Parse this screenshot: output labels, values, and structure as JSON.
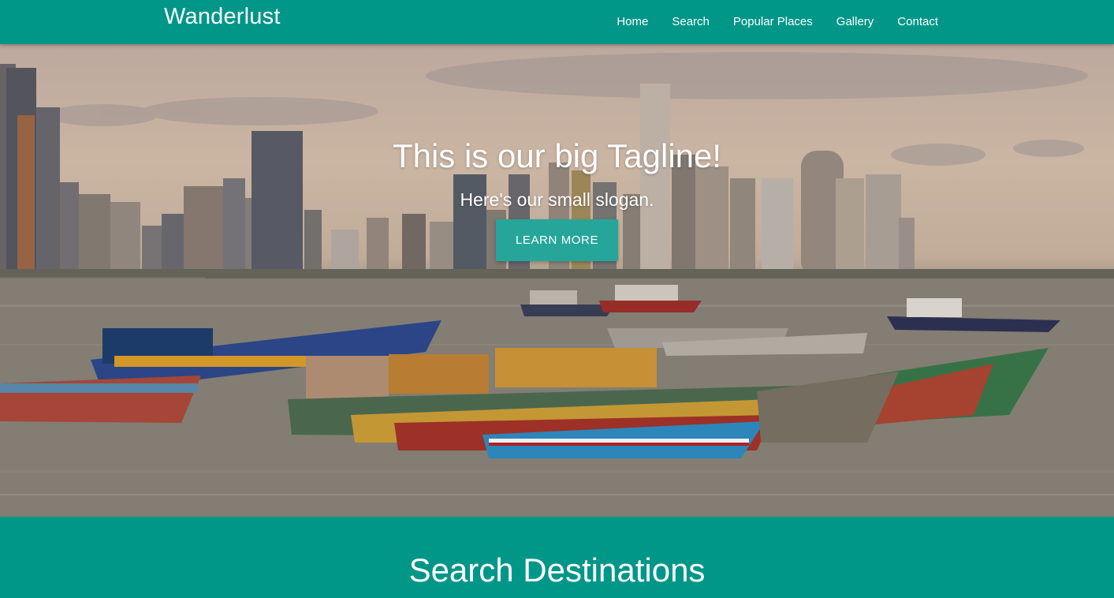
{
  "nav": {
    "brand": "Wanderlust",
    "links": [
      "Home",
      "Search",
      "Popular Places",
      "Gallery",
      "Contact"
    ]
  },
  "hero": {
    "tagline": "This is our big Tagline!",
    "slogan": "Here's our small slogan.",
    "button_label": "LEARN MORE",
    "image_alt": "city skyline with colorful fishing boats on the bay"
  },
  "search_section": {
    "title": "Search Destinations"
  },
  "colors": {
    "primary": "#009688",
    "button": "#26a69a",
    "text": "#ffffff"
  }
}
